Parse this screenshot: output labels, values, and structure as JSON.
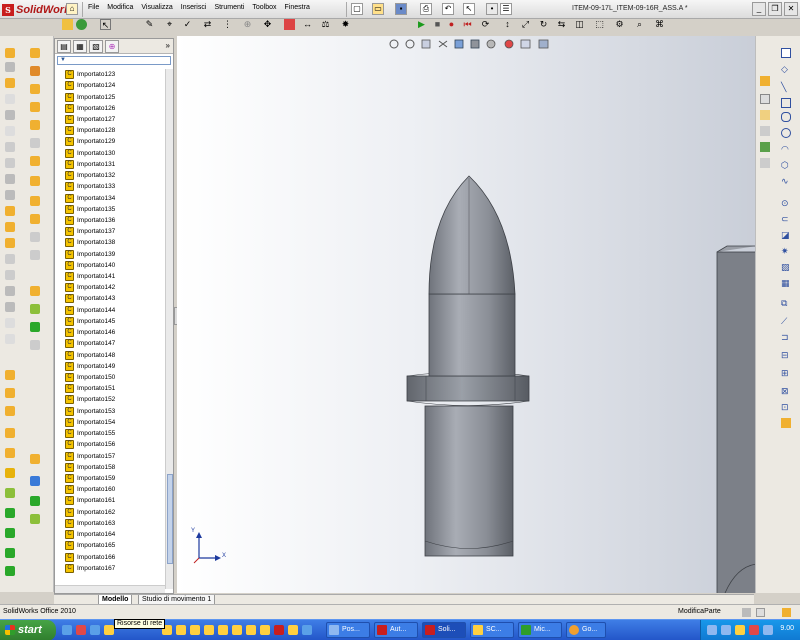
{
  "app": {
    "name": "SolidWorks"
  },
  "menu": [
    "File",
    "Modifica",
    "Visualizza",
    "Inserisci",
    "Strumenti",
    "Toolbox",
    "Finestra"
  ],
  "window": {
    "document_title": "ITEM-09-17L_ITEM-09-16R_ASS.A *"
  },
  "tree": {
    "filter_icon": "filter-icon",
    "items": [
      "Importato123",
      "Importato124",
      "Importato125",
      "Importato126",
      "Importato127",
      "Importato128",
      "Importato129",
      "Importato130",
      "Importato131",
      "Importato132",
      "Importato133",
      "Importato134",
      "Importato135",
      "Importato136",
      "Importato137",
      "Importato138",
      "Importato139",
      "Importato140",
      "Importato141",
      "Importato142",
      "Importato143",
      "Importato144",
      "Importato145",
      "Importato146",
      "Importato147",
      "Importato148",
      "Importato149",
      "Importato150",
      "Importato151",
      "Importato152",
      "Importato153",
      "Importato154",
      "Importato155",
      "Importato156",
      "Importato157",
      "Importato158",
      "Importato159",
      "Importato160",
      "Importato161",
      "Importato162",
      "Importato163",
      "Importato164",
      "Importato165",
      "Importato166",
      "Importato167"
    ]
  },
  "model_tabs": {
    "active": "Modello",
    "other": "Studio di movimento 1"
  },
  "status": {
    "left": "SolidWorks Office 2010",
    "right": "ModificaParte"
  },
  "triad": {
    "y_label": "Y",
    "x_label": "X"
  },
  "taskbar": {
    "start_label": "start",
    "tooltip": "Risorse di rete",
    "buttons": [
      "Pos...",
      "Aut...",
      "Soli...",
      "SC...",
      "Mic...",
      "Go..."
    ],
    "clock": "9.00"
  },
  "colors": {
    "brand_red": "#c81e1e",
    "taskbar_blue": "#2356c9",
    "part_gray": "#8f939a"
  }
}
